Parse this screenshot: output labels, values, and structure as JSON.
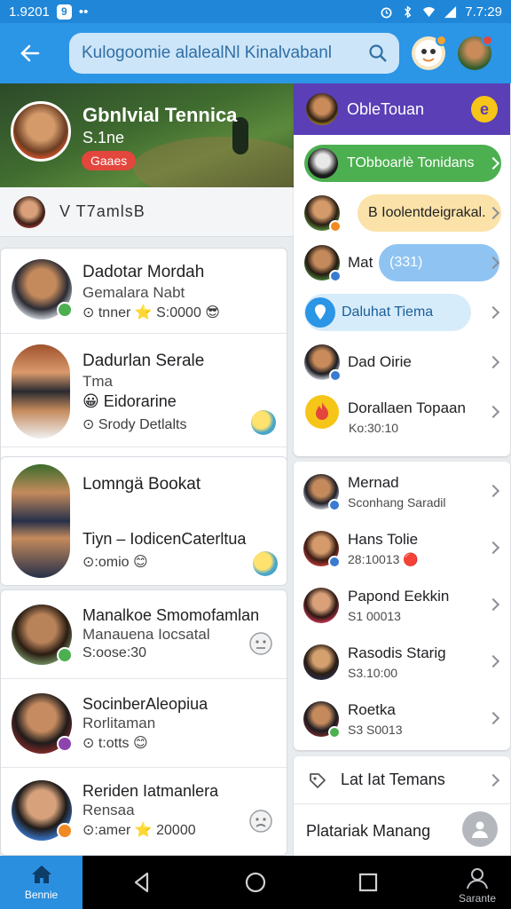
{
  "status_bar": {
    "time_left": "1.9201",
    "badge": "9",
    "dots": "••",
    "time_right": "7.7:29"
  },
  "header": {
    "search_text": "Kulogoomie alalealNl Kinalvabanl"
  },
  "hero": {
    "title": "Gbnlvial Tennica",
    "subtitle": "S.1ne",
    "badge": "Gaaes"
  },
  "group": {
    "label": "V T7amlsB"
  },
  "contacts_left": [
    {
      "name": "Dadotar Mordah",
      "line2": "Gemalara Nabt",
      "line3": "⊙ tnner ⭐ S:0000 😎"
    },
    {
      "name": "Dadurlan Serale",
      "line2": "Tma",
      "line2b": "😀 Eidorarine",
      "line3": "⊙ Srody Detlalts"
    },
    {
      "name": "Lomngä Bookat",
      "line2": "Tiyn – IodicenCaterltua",
      "line3": "⊙:omio 😊"
    },
    {
      "name": "Manalkoe Smomofamlan",
      "line2": "Manauena Iocsatal",
      "line3": "S:oose:30"
    },
    {
      "name": "SocinberAleopiua",
      "line2": "Rorlitaman",
      "line3": "⊙ t:otts 😊"
    },
    {
      "name": "Reriden Iatmanlera",
      "line2": "Rensaa",
      "line3": "⊙:amer ⭐ 20000"
    }
  ],
  "right_header": {
    "title": "ObleTouan",
    "badge": "e"
  },
  "right_rows": [
    {
      "text": "TObboarlè Tonidans",
      "pill_color": "#4caf50"
    },
    {
      "text": "B  Ioolentdeigrakal.",
      "pill_color": "#fbe2a8"
    },
    {
      "text": "Mat",
      "pill_text": "(331)",
      "pill_color": "#8fc3f2"
    },
    {
      "text": "Daluhat Tiema",
      "pill_color": "#d7ecfb"
    },
    {
      "text": "Dad Oirie"
    },
    {
      "text": "Dorallaen Topaan",
      "sub": "Ko:30:10"
    }
  ],
  "people": [
    {
      "name": "Mernad",
      "sub": "Sconhang Saradil"
    },
    {
      "name": "Hans Tolie",
      "sub": "28:10013 🔴"
    },
    {
      "name": "Papond Eekkin",
      "sub": "S1 00013"
    },
    {
      "name": "Rasodis Starig",
      "sub": "S3.10:00"
    },
    {
      "name": "Roetka",
      "sub": "S3 S0013"
    }
  ],
  "actions": {
    "latest": "Lat Iat Temans",
    "manage": "Platariak Manang"
  },
  "bottom_nav": {
    "home_label": "Bennie",
    "profile_label": "Sarante"
  },
  "colors": {
    "primary": "#2b95e6",
    "header_purple": "#5a3fb6",
    "hero_badge": "#e2463c"
  }
}
